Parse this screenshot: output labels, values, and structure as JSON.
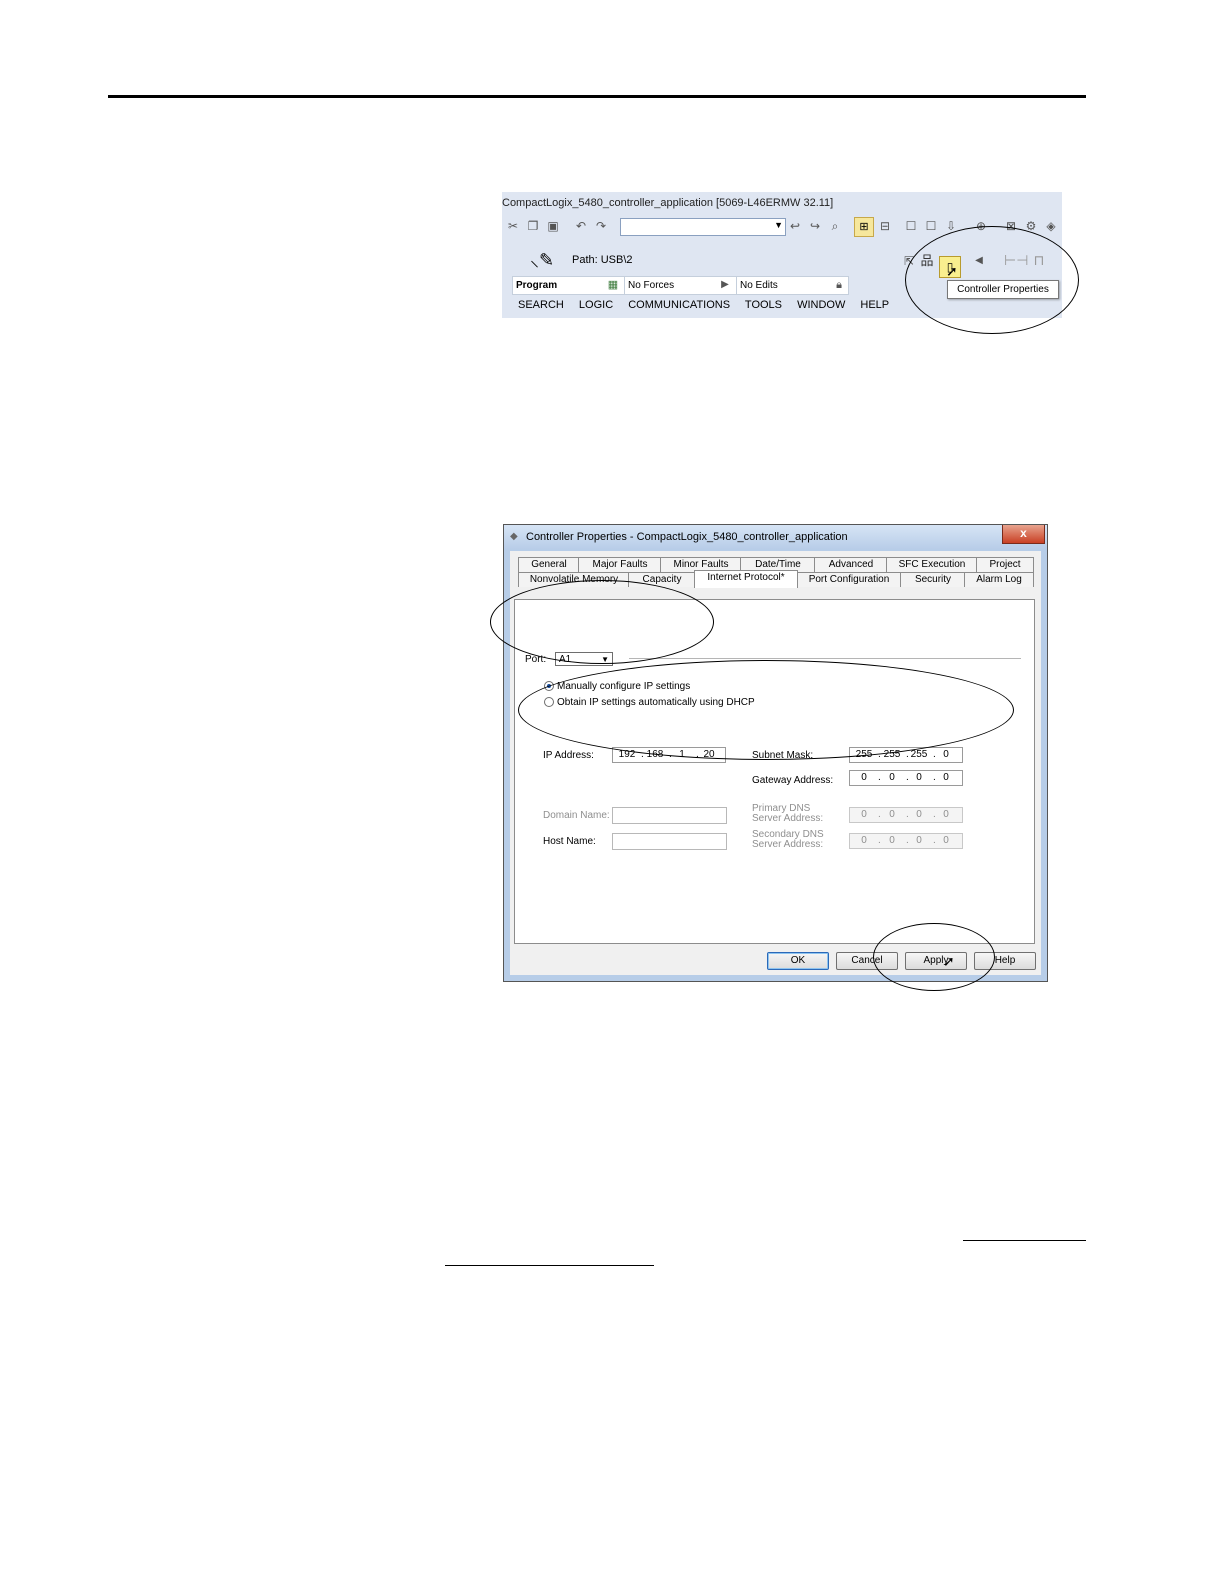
{
  "toolbar_shot": {
    "title": "CompactLogix_5480_controller_application [5069-L46ERMW 32.11]",
    "path_label": "Path: USB\\2",
    "mode": "Program",
    "forces": "No Forces",
    "edits": "No Edits",
    "menus": [
      "SEARCH",
      "LOGIC",
      "COMMUNICATIONS",
      "TOOLS",
      "WINDOW",
      "HELP"
    ],
    "tooltip": "Controller Properties"
  },
  "dialog": {
    "title": "Controller Properties - CompactLogix_5480_controller_application",
    "close": "x",
    "tabs_row1": [
      "General",
      "Major Faults",
      "Minor Faults",
      "Date/Time",
      "Advanced",
      "SFC Execution",
      "Project"
    ],
    "tabs_row2": [
      "Nonvolatile Memory",
      "Capacity",
      "Internet Protocol*",
      "Port Configuration",
      "Security",
      "Alarm Log"
    ],
    "port_label": "Port:",
    "port_value": "A1",
    "radio_manual": "Manually configure IP settings",
    "radio_dhcp": "Obtain IP settings automatically using DHCP",
    "ip_label": "IP Address:",
    "ip": [
      "192",
      "168",
      "1",
      "20"
    ],
    "subnet_label": "Subnet Mask:",
    "subnet": [
      "255",
      "255",
      "255",
      "0"
    ],
    "gateway_label": "Gateway Address:",
    "gateway": [
      "0",
      "0",
      "0",
      "0"
    ],
    "domain_label": "Domain Name:",
    "host_label": "Host Name:",
    "dns1_label": "Primary DNS Server Address:",
    "dns1": [
      "0",
      "0",
      "0",
      "0"
    ],
    "dns2_label": "Secondary DNS Server Address:",
    "dns2": [
      "0",
      "0",
      "0",
      "0"
    ],
    "buttons": {
      "ok": "OK",
      "cancel": "Cancel",
      "apply": "Apply",
      "help": "Help"
    }
  }
}
